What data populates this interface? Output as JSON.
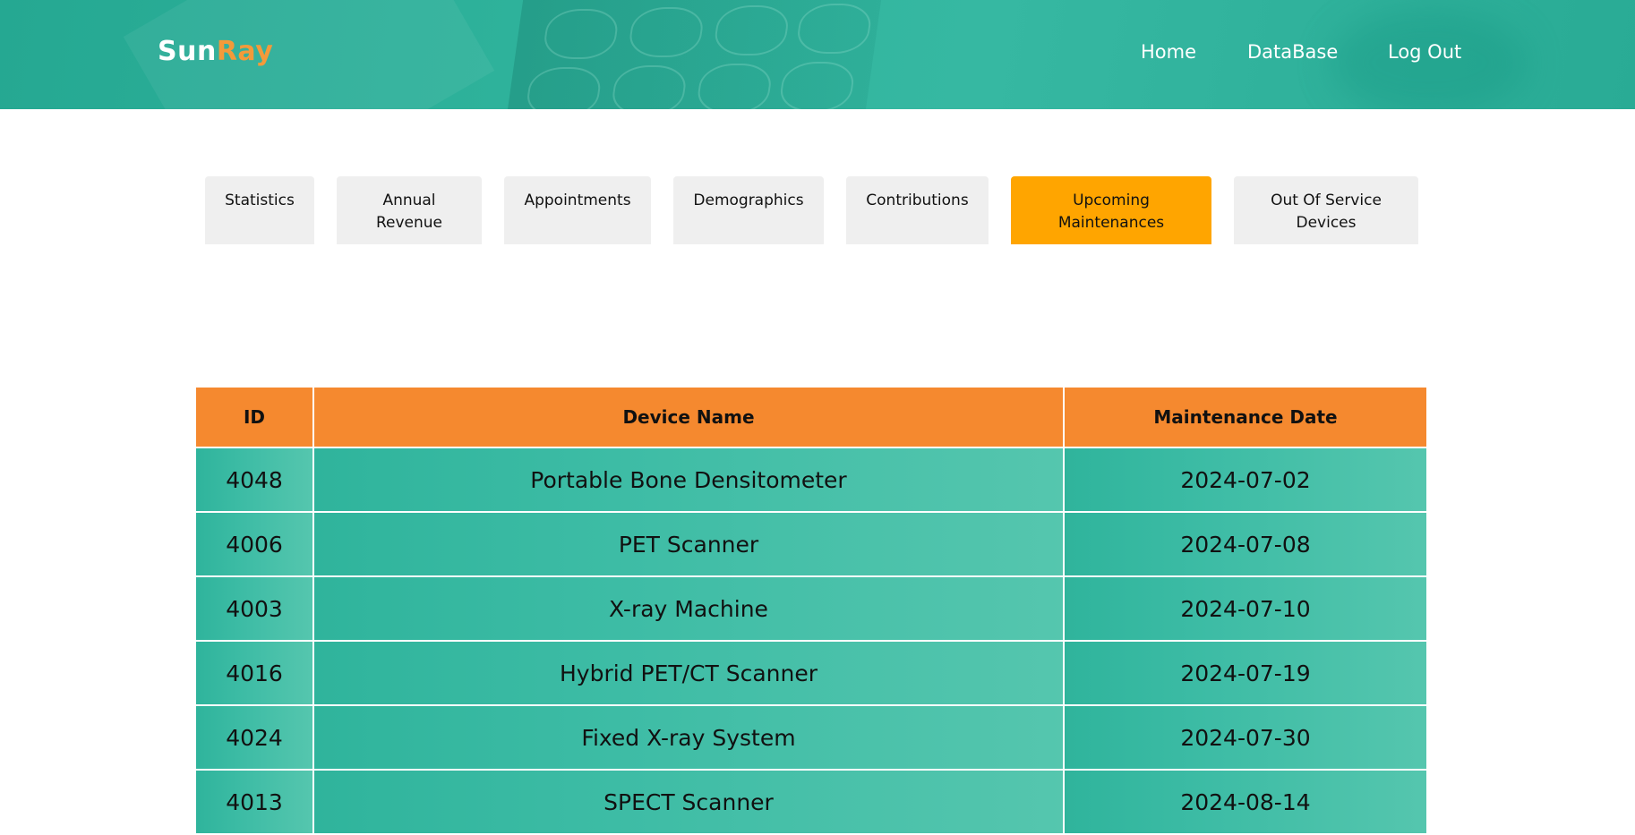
{
  "header": {
    "logo_part1": "Sun",
    "logo_part2": "Ray",
    "nav": [
      "Home",
      "DataBase",
      "Log Out"
    ]
  },
  "tabs": [
    {
      "label": "Statistics",
      "active": false
    },
    {
      "label": "Annual\nRevenue",
      "active": false
    },
    {
      "label": "Appointments",
      "active": false
    },
    {
      "label": "Demographics",
      "active": false
    },
    {
      "label": "Contributions",
      "active": false
    },
    {
      "label": "Upcoming\nMaintenances",
      "active": true
    },
    {
      "label": "Out Of Service\nDevices",
      "active": false
    }
  ],
  "table": {
    "columns": [
      "ID",
      "Device Name",
      "Maintenance Date"
    ],
    "rows": [
      [
        "4048",
        "Portable Bone Densitometer",
        "2024-07-02"
      ],
      [
        "4006",
        "PET Scanner",
        "2024-07-08"
      ],
      [
        "4003",
        "X-ray Machine",
        "2024-07-10"
      ],
      [
        "4016",
        "Hybrid PET/CT Scanner",
        "2024-07-19"
      ],
      [
        "4024",
        "Fixed X-ray System",
        "2024-07-30"
      ],
      [
        "4013",
        "SPECT Scanner",
        "2024-08-14"
      ]
    ]
  },
  "colors": {
    "header_teal": "#2fb39c",
    "logo_accent": "#f39a3a",
    "tab_active": "#ffa500",
    "tab_inactive": "#efefef",
    "table_header": "#f5892f",
    "row_teal": "#3dbca5"
  }
}
